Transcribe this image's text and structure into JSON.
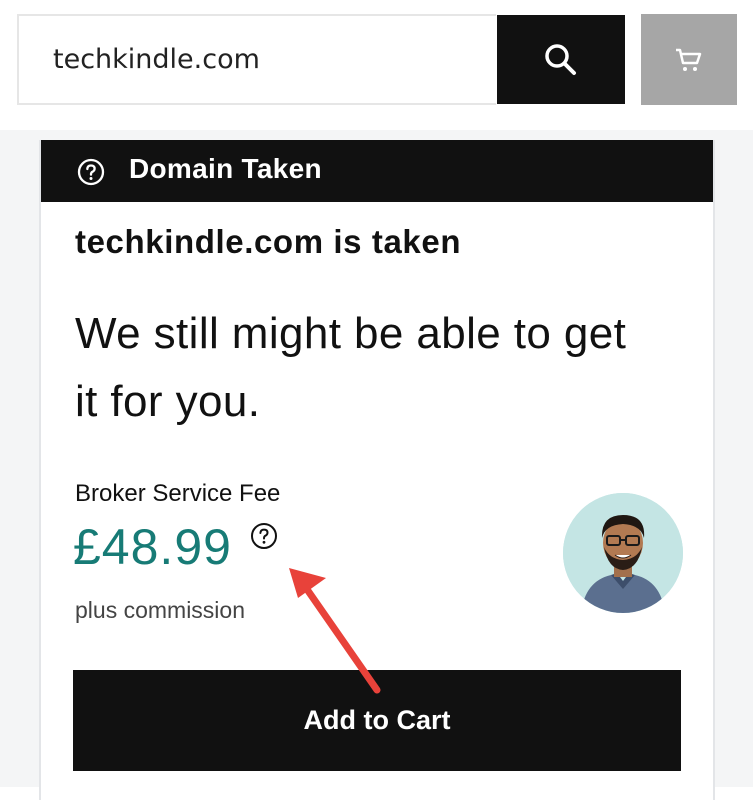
{
  "search": {
    "value": "techkindle.com",
    "icon": "search-icon"
  },
  "cart": {
    "icon": "cart-icon"
  },
  "banner": {
    "icon": "help-circle-icon",
    "text": "Domain Taken"
  },
  "result": {
    "title": "techkindle.com is taken",
    "headline": "We still might be able to get it for you.",
    "fee_label": "Broker Service Fee",
    "price": "£48.99",
    "price_help_icon": "help-circle-icon",
    "commission": "plus commission",
    "add_to_cart_label": "Add to Cart"
  },
  "colors": {
    "price": "#177b76",
    "dark": "#111111",
    "cart_disabled": "#a6a6a6",
    "annotation_arrow": "#e8423a"
  }
}
